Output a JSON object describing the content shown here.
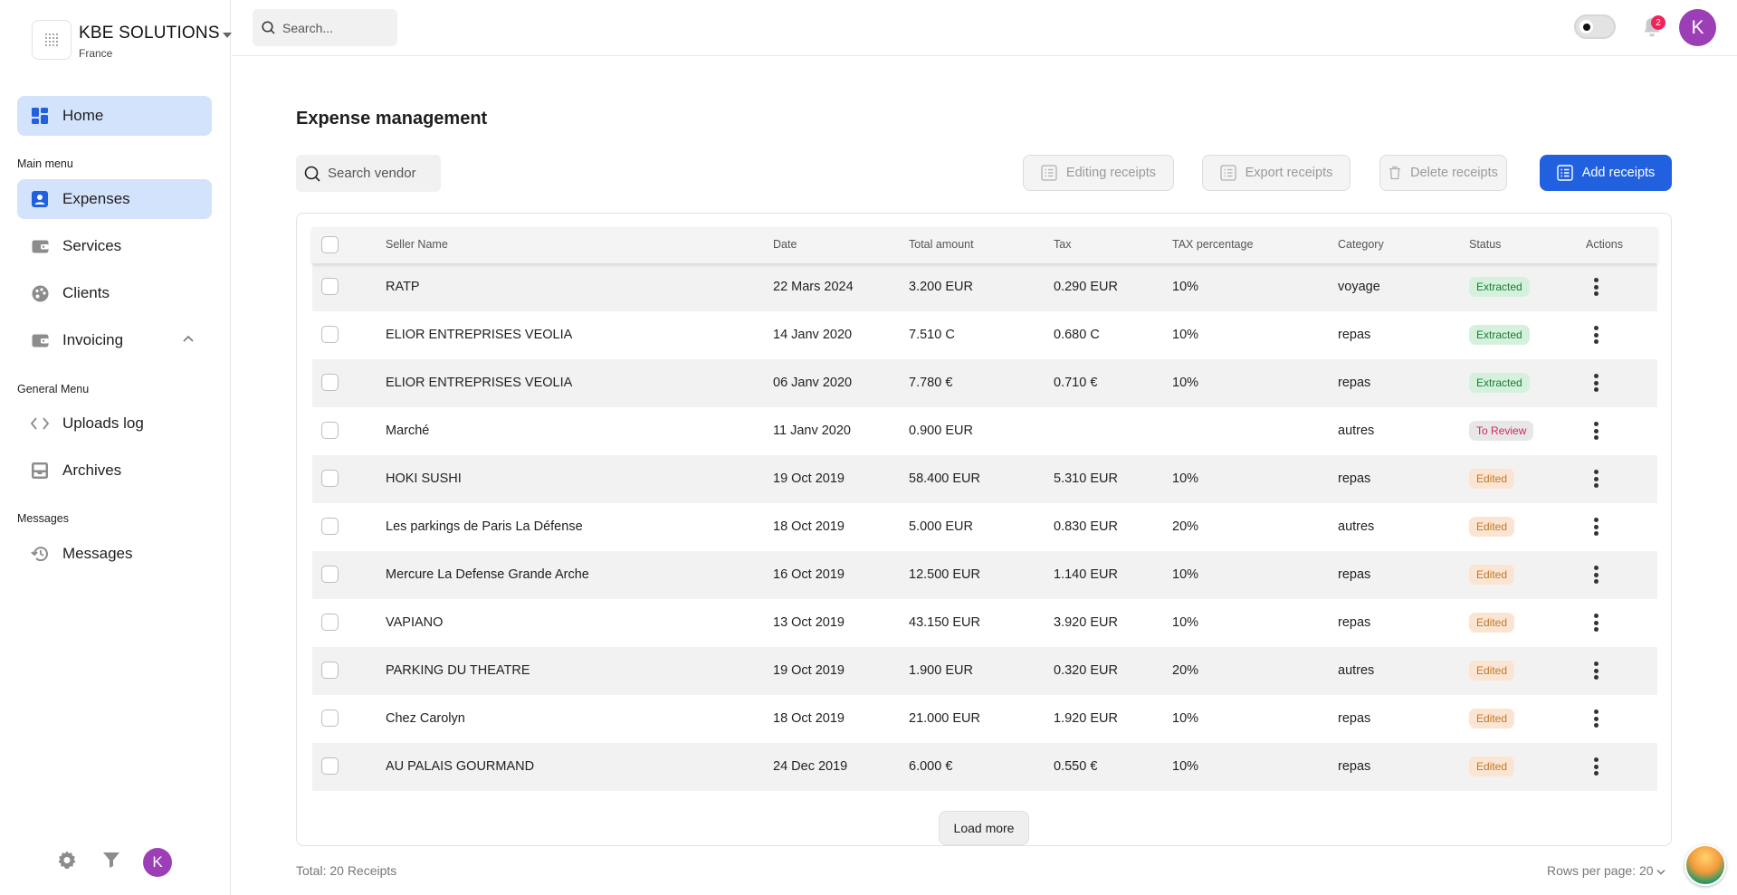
{
  "org": {
    "name": "KBE SOLUTIONS",
    "country": "France"
  },
  "sidebar": {
    "home": "Home",
    "main_menu_label": "Main menu",
    "expenses": "Expenses",
    "services": "Services",
    "clients": "Clients",
    "invoicing": "Invoicing",
    "general_menu_label": "General Menu",
    "uploads_log": "Uploads log",
    "archives": "Archives",
    "messages_label": "Messages",
    "messages": "Messages",
    "avatar_initial": "K"
  },
  "topbar": {
    "search_placeholder": "Search...",
    "notification_count": "2",
    "avatar_initial": "K"
  },
  "page": {
    "title": "Expense management",
    "vendor_search_placeholder": "Search vendor",
    "buttons": {
      "editing": "Editing receipts",
      "export": "Export receipts",
      "delete": "Delete receipts",
      "add": "Add receipts"
    }
  },
  "table": {
    "columns": [
      "Seller Name",
      "Date",
      "Total amount",
      "Tax",
      "TAX percentage",
      "Category",
      "Status",
      "Actions"
    ],
    "rows": [
      {
        "seller": "RATP",
        "date": "22 Mars 2024",
        "total": "3.200 EUR",
        "tax": "0.290 EUR",
        "pct": "10%",
        "category": "voyage",
        "status": "Extracted",
        "status_type": "extracted"
      },
      {
        "seller": "ELIOR ENTREPRISES VEOLIA",
        "date": "14 Janv 2020",
        "total": "7.510 C",
        "tax": "0.680 C",
        "pct": "10%",
        "category": "repas",
        "status": "Extracted",
        "status_type": "extracted"
      },
      {
        "seller": "ELIOR ENTREPRISES VEOLIA",
        "date": "06 Janv 2020",
        "total": "7.780 €",
        "tax": "0.710 €",
        "pct": "10%",
        "category": "repas",
        "status": "Extracted",
        "status_type": "extracted"
      },
      {
        "seller": "Marché",
        "date": "11 Janv 2020",
        "total": "0.900 EUR",
        "tax": "",
        "pct": "",
        "category": "autres",
        "status": "To Review",
        "status_type": "review"
      },
      {
        "seller": "HOKI SUSHI",
        "date": "19 Oct 2019",
        "total": "58.400 EUR",
        "tax": "5.310 EUR",
        "pct": "10%",
        "category": "repas",
        "status": "Edited",
        "status_type": "edited"
      },
      {
        "seller": "Les parkings de Paris La Défense",
        "date": "18 Oct 2019",
        "total": "5.000 EUR",
        "tax": "0.830 EUR",
        "pct": "20%",
        "category": "autres",
        "status": "Edited",
        "status_type": "edited"
      },
      {
        "seller": "Mercure La Defense Grande Arche",
        "date": "16 Oct 2019",
        "total": "12.500 EUR",
        "tax": "1.140 EUR",
        "pct": "10%",
        "category": "repas",
        "status": "Edited",
        "status_type": "edited"
      },
      {
        "seller": "VAPIANO",
        "date": "13 Oct 2019",
        "total": "43.150 EUR",
        "tax": "3.920 EUR",
        "pct": "10%",
        "category": "repas",
        "status": "Edited",
        "status_type": "edited"
      },
      {
        "seller": "PARKING DU THEATRE",
        "date": "19 Oct 2019",
        "total": "1.900 EUR",
        "tax": "0.320 EUR",
        "pct": "20%",
        "category": "autres",
        "status": "Edited",
        "status_type": "edited"
      },
      {
        "seller": "Chez Carolyn",
        "date": "18 Oct 2019",
        "total": "21.000 EUR",
        "tax": "1.920 EUR",
        "pct": "10%",
        "category": "repas",
        "status": "Edited",
        "status_type": "edited"
      },
      {
        "seller": "AU PALAIS GOURMAND",
        "date": "24 Dec 2019",
        "total": "6.000 €",
        "tax": "0.550 €",
        "pct": "10%",
        "category": "repas",
        "status": "Edited",
        "status_type": "edited"
      }
    ],
    "load_more": "Load more",
    "total_label": "Total: 20 Receipts",
    "rows_per_page_label": "Rows per page:",
    "rows_per_page_value": "20"
  },
  "colors": {
    "accent": "#2161e0",
    "active_nav": "#d3e3fb",
    "avatar": "#9c3fb6",
    "badge_red": "#f0245b"
  }
}
